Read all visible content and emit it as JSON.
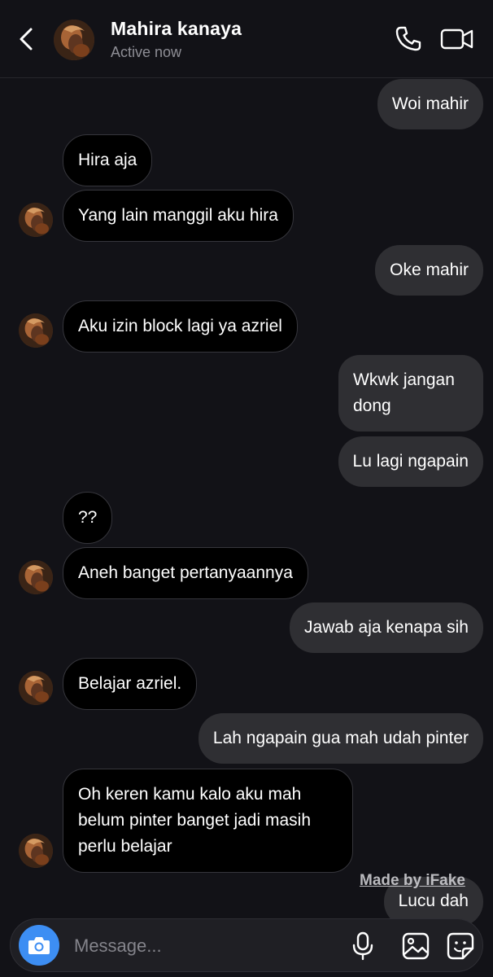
{
  "header": {
    "contact_name": "Mahira kanaya",
    "status": "Active now",
    "icons": [
      "back-icon",
      "phone-icon",
      "video-camera-icon"
    ]
  },
  "messages": [
    {
      "sender": "me",
      "text": "Woi mahir"
    },
    {
      "sender": "contact",
      "text": "Hira aja"
    },
    {
      "sender": "contact",
      "text": "Yang lain manggil aku hira"
    },
    {
      "sender": "me",
      "text": "Oke mahir"
    },
    {
      "sender": "contact",
      "text": "Aku izin block lagi ya azriel"
    },
    {
      "sender": "me",
      "text": "Wkwk jangan dong"
    },
    {
      "sender": "me",
      "text": "Lu lagi ngapain"
    },
    {
      "sender": "contact",
      "text": "??"
    },
    {
      "sender": "contact",
      "text": "Aneh banget pertanyaannya"
    },
    {
      "sender": "me",
      "text": "Jawab aja kenapa sih"
    },
    {
      "sender": "contact",
      "text": "Belajar azriel."
    },
    {
      "sender": "me",
      "text": "Lah ngapain gua mah udah pinter"
    },
    {
      "sender": "contact",
      "text": "Oh keren kamu kalo aku mah belum pinter banget jadi masih perlu belajar"
    },
    {
      "sender": "me",
      "text": "Lucu dah"
    }
  ],
  "watermark": "Made by iFake",
  "composer": {
    "placeholder": "Message...",
    "icons": [
      "camera-icon",
      "microphone-icon",
      "gallery-icon",
      "sticker-icon"
    ]
  },
  "colors": {
    "background": "#121217",
    "outgoing_bubble": "#2f2f33",
    "incoming_bubble": "#000000",
    "camera_button": "#3d8ef3"
  }
}
